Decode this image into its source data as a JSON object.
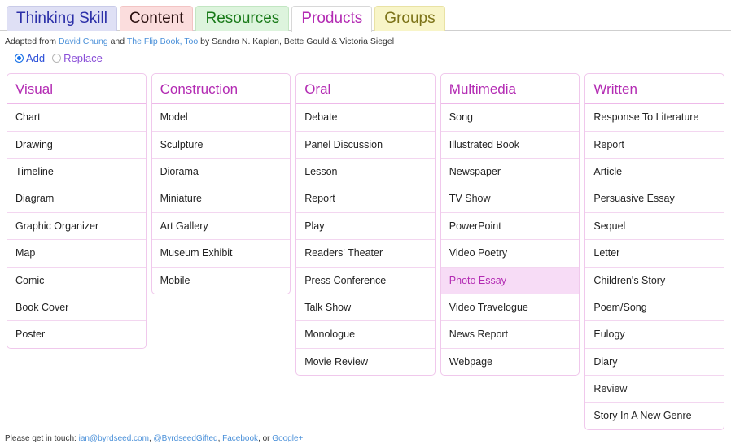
{
  "tabs": [
    {
      "label": "Thinking Skill",
      "active": false,
      "theme": "t-thinking"
    },
    {
      "label": "Content",
      "active": false,
      "theme": "t-content"
    },
    {
      "label": "Resources",
      "active": false,
      "theme": "t-resources"
    },
    {
      "label": "Products",
      "active": true,
      "theme": "t-products"
    },
    {
      "label": "Groups",
      "active": false,
      "theme": "t-groups"
    }
  ],
  "attribution": {
    "prefix": "Adapted from ",
    "link1": "David Chung",
    "mid": " and ",
    "link2": "The Flip Book, Too",
    "suffix": " by Sandra N. Kaplan, Bette Gould & Victoria Siegel"
  },
  "mode": {
    "add_label": "Add",
    "replace_label": "Replace",
    "selected": "Add"
  },
  "columns": [
    {
      "title": "Visual",
      "items": [
        "Chart",
        "Drawing",
        "Timeline",
        "Diagram",
        "Graphic Organizer",
        "Map",
        "Comic",
        "Book Cover",
        "Poster"
      ]
    },
    {
      "title": "Construction",
      "items": [
        "Model",
        "Sculpture",
        "Diorama",
        "Miniature",
        "Art Gallery",
        "Museum Exhibit",
        "Mobile"
      ]
    },
    {
      "title": "Oral",
      "items": [
        "Debate",
        "Panel Discussion",
        "Lesson",
        "Report",
        "Play",
        "Readers' Theater",
        "Press Conference",
        "Talk Show",
        "Monologue",
        "Movie Review"
      ]
    },
    {
      "title": "Multimedia",
      "items": [
        "Song",
        "Illustrated Book",
        "Newspaper",
        "TV Show",
        "PowerPoint",
        "Video Poetry",
        "Photo Essay",
        "Video Travelogue",
        "News Report",
        "Webpage"
      ],
      "selected": "Photo Essay"
    },
    {
      "title": "Written",
      "items": [
        "Response To Literature",
        "Report",
        "Article",
        "Persuasive Essay",
        "Sequel",
        "Letter",
        "Children's Story",
        "Poem/Song",
        "Eulogy",
        "Diary",
        "Review",
        "Story In A New Genre"
      ]
    }
  ],
  "footer": {
    "prefix": "Please get in touch: ",
    "email": "ian@byrdseed.com",
    "sep1": ", ",
    "twitter": "@ByrdseedGifted",
    "sep2": ", ",
    "facebook": "Facebook",
    "sep3": ", or ",
    "google": "Google+"
  },
  "colors": {
    "accent": "#b32bb3",
    "border": "#f0c8ec",
    "selected_bg": "#f7dcf6",
    "link": "#4a90d9",
    "radio_on": "#1a73e8"
  }
}
